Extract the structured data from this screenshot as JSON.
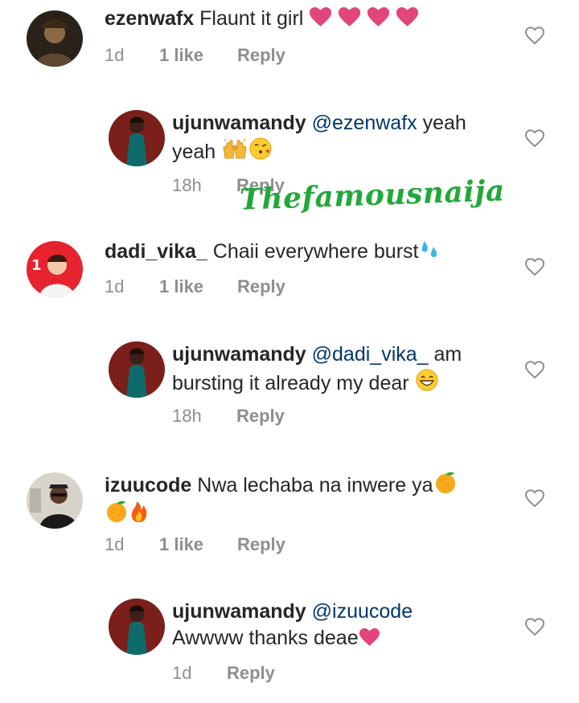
{
  "comments": [
    {
      "username": "ezenwafx",
      "text": " Flaunt it girl ",
      "emojis": [
        "heart",
        "heart",
        "heart",
        "heart"
      ],
      "age": "1d",
      "likes": "1 like",
      "reply": "Reply",
      "avatar": "painting-avatar"
    },
    {
      "username": "ujunwamandy",
      "mention": "@ezenwafx",
      "text_line1_rest": " yeah",
      "text_line2": "yeah ",
      "emojis": [
        "raising-hands",
        "kissing-face"
      ],
      "age": "18h",
      "reply": "Reply",
      "avatar": "woman-avatar"
    },
    {
      "username": "dadi_vika_",
      "text": " Chaii everywhere burst",
      "emojis": [
        "sweat-droplets"
      ],
      "age": "1d",
      "likes": "1 like",
      "reply": "Reply",
      "avatar": "cartoon-avatar"
    },
    {
      "username": "ujunwamandy",
      "mention": "@dadi_vika_",
      "text_line1_rest": " am",
      "text_line2": "bursting it already my dear ",
      "emojis": [
        "grinning-face"
      ],
      "age": "18h",
      "reply": "Reply",
      "avatar": "woman-avatar"
    },
    {
      "username": "izuucode",
      "text": " Nwa lechaba na inwere ya",
      "emojis_line1": [
        "tangerine"
      ],
      "emojis_line2": [
        "tangerine",
        "fire"
      ],
      "age": "1d",
      "likes": "1 like",
      "reply": "Reply",
      "avatar": "man-avatar"
    },
    {
      "username": "ujunwamandy",
      "mention": "@izuucode",
      "text_line2": "Awwww thanks deae",
      "emojis": [
        "heart"
      ],
      "age": "1d",
      "reply": "Reply",
      "avatar": "woman-avatar"
    }
  ],
  "watermark": "Thefamousnaija",
  "colors": {
    "text": "#262626",
    "meta": "#8e8e8e",
    "mention": "#00376b",
    "heart": "#e0457b",
    "watermark": "#22a83a"
  }
}
